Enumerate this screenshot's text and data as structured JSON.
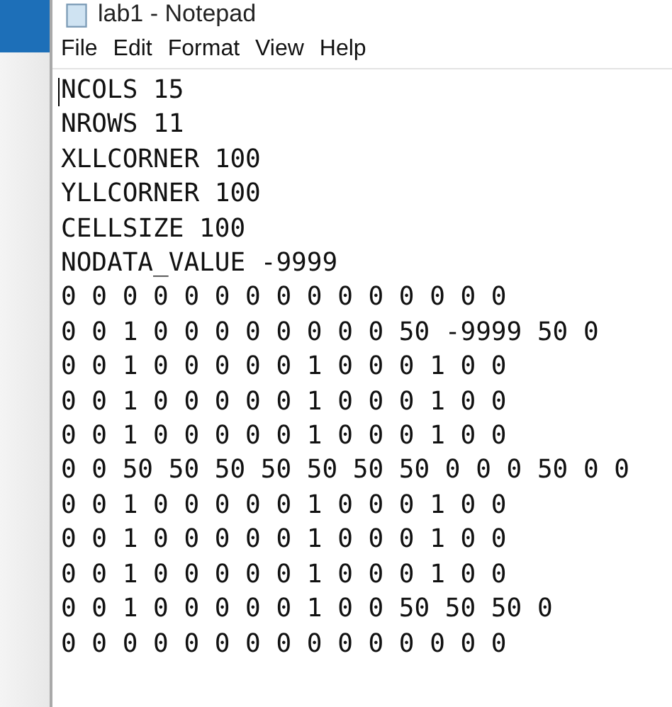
{
  "window": {
    "title": "lab1 - Notepad"
  },
  "menu": [
    "File",
    "Edit",
    "Format",
    "View",
    "Help"
  ],
  "lines": [
    "NCOLS 15",
    "NROWS 11",
    "XLLCORNER 100",
    "YLLCORNER 100",
    "CELLSIZE 100",
    "NODATA_VALUE -9999",
    "0 0 0 0 0 0 0 0 0 0 0 0 0 0 0",
    "0 0 1 0 0 0 0 0 0 0 0 50 -9999 50 0",
    "0 0 1 0 0 0 0 0 1 0 0 0 1 0 0",
    "0 0 1 0 0 0 0 0 1 0 0 0 1 0 0",
    "0 0 1 0 0 0 0 0 1 0 0 0 1 0 0",
    "0 0 50 50 50 50 50 50 50 0 0 0 50 0 0",
    "0 0 1 0 0 0 0 0 1 0 0 0 1 0 0",
    "0 0 1 0 0 0 0 0 1 0 0 0 1 0 0",
    "0 0 1 0 0 0 0 0 1 0 0 0 1 0 0",
    "0 0 1 0 0 0 0 0 1 0 0 50 50 50 0",
    "0 0 0 0 0 0 0 0 0 0 0 0 0 0 0"
  ]
}
